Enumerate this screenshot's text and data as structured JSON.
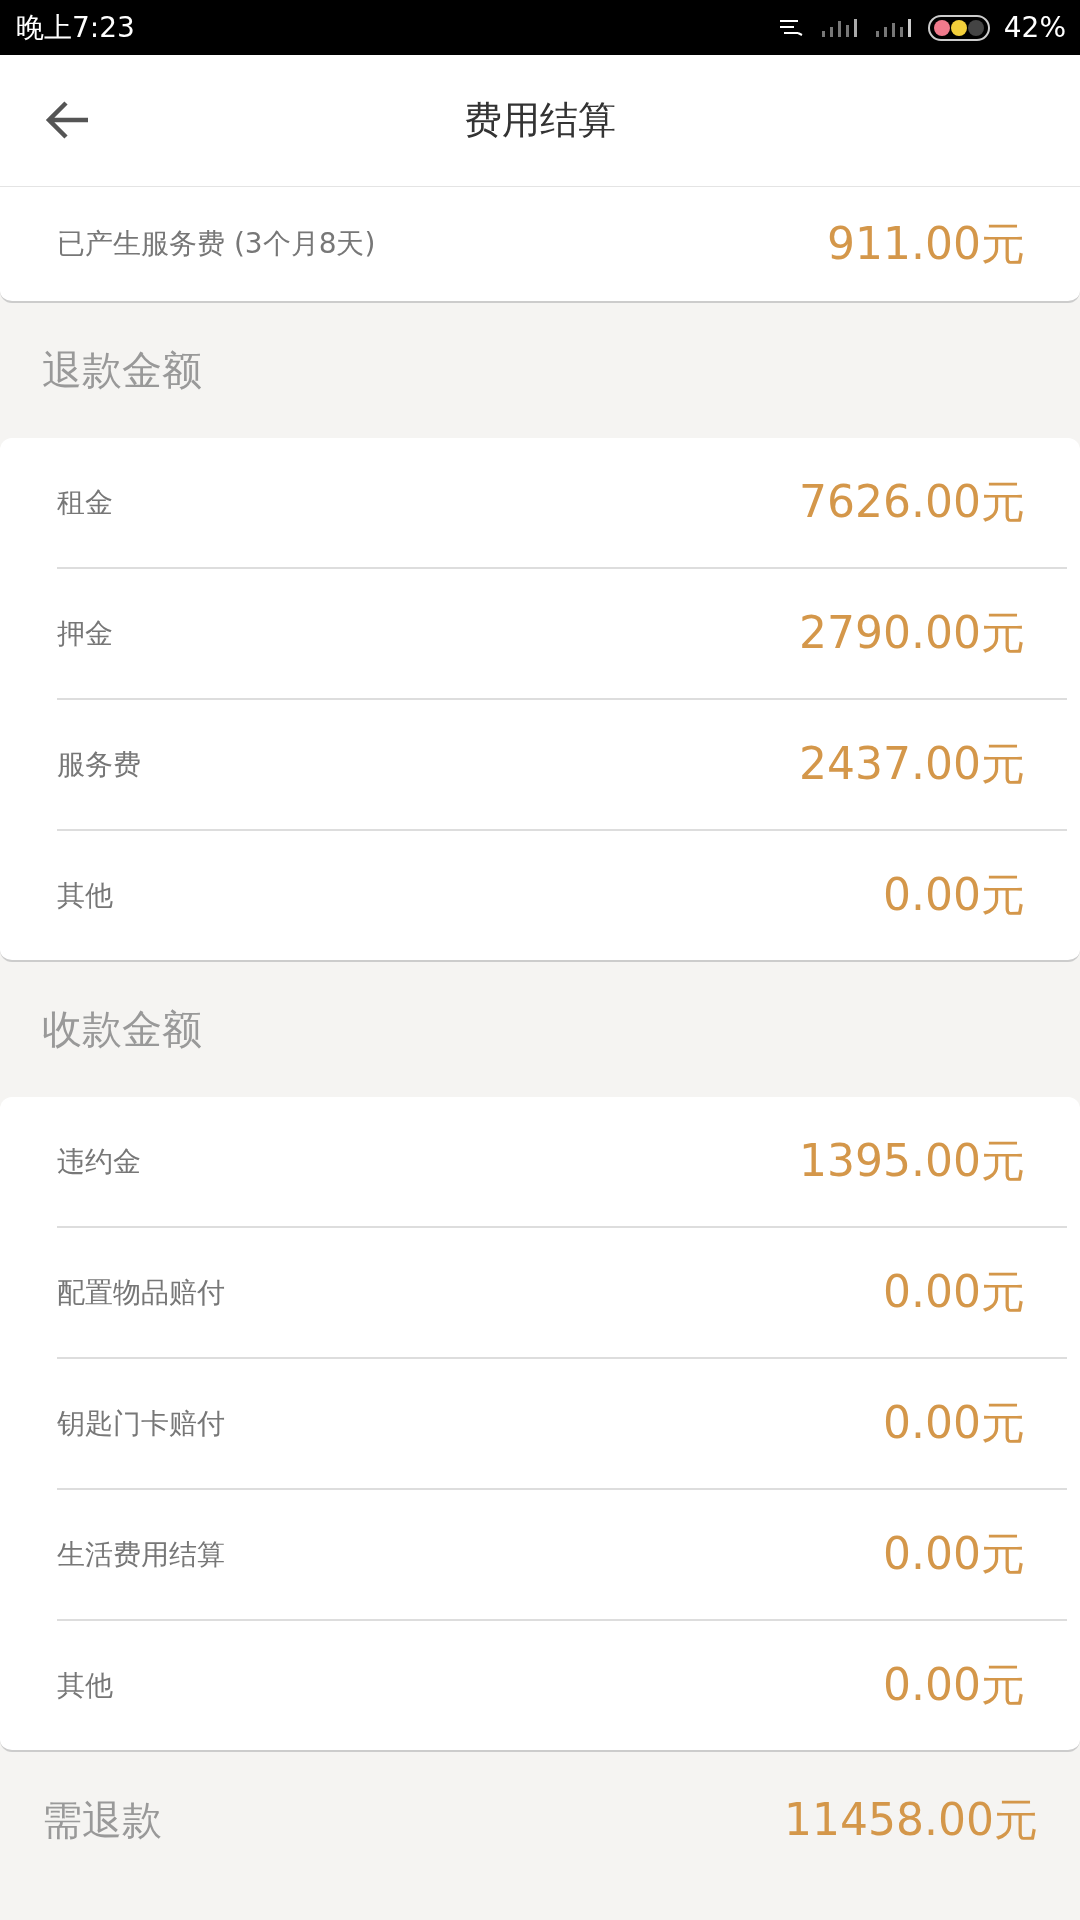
{
  "status_bar": {
    "time": "晚上7:23",
    "battery": "42%"
  },
  "header": {
    "title": "费用结算"
  },
  "summary": {
    "label": "已产生服务费 (3个月8天)",
    "amount": "911.00元"
  },
  "sections": [
    {
      "title": "退款金额",
      "rows": [
        {
          "label": "租金",
          "amount": "7626.00元"
        },
        {
          "label": "押金",
          "amount": "2790.00元"
        },
        {
          "label": "服务费",
          "amount": "2437.00元"
        },
        {
          "label": "其他",
          "amount": "0.00元"
        }
      ]
    },
    {
      "title": "收款金额",
      "rows": [
        {
          "label": "违约金",
          "amount": "1395.00元"
        },
        {
          "label": "配置物品赔付",
          "amount": "0.00元"
        },
        {
          "label": "钥匙门卡赔付",
          "amount": "0.00元"
        },
        {
          "label": "生活费用结算",
          "amount": "0.00元"
        },
        {
          "label": "其他",
          "amount": "0.00元"
        }
      ]
    }
  ],
  "total": {
    "label": "需退款",
    "amount": "11458.00元"
  }
}
